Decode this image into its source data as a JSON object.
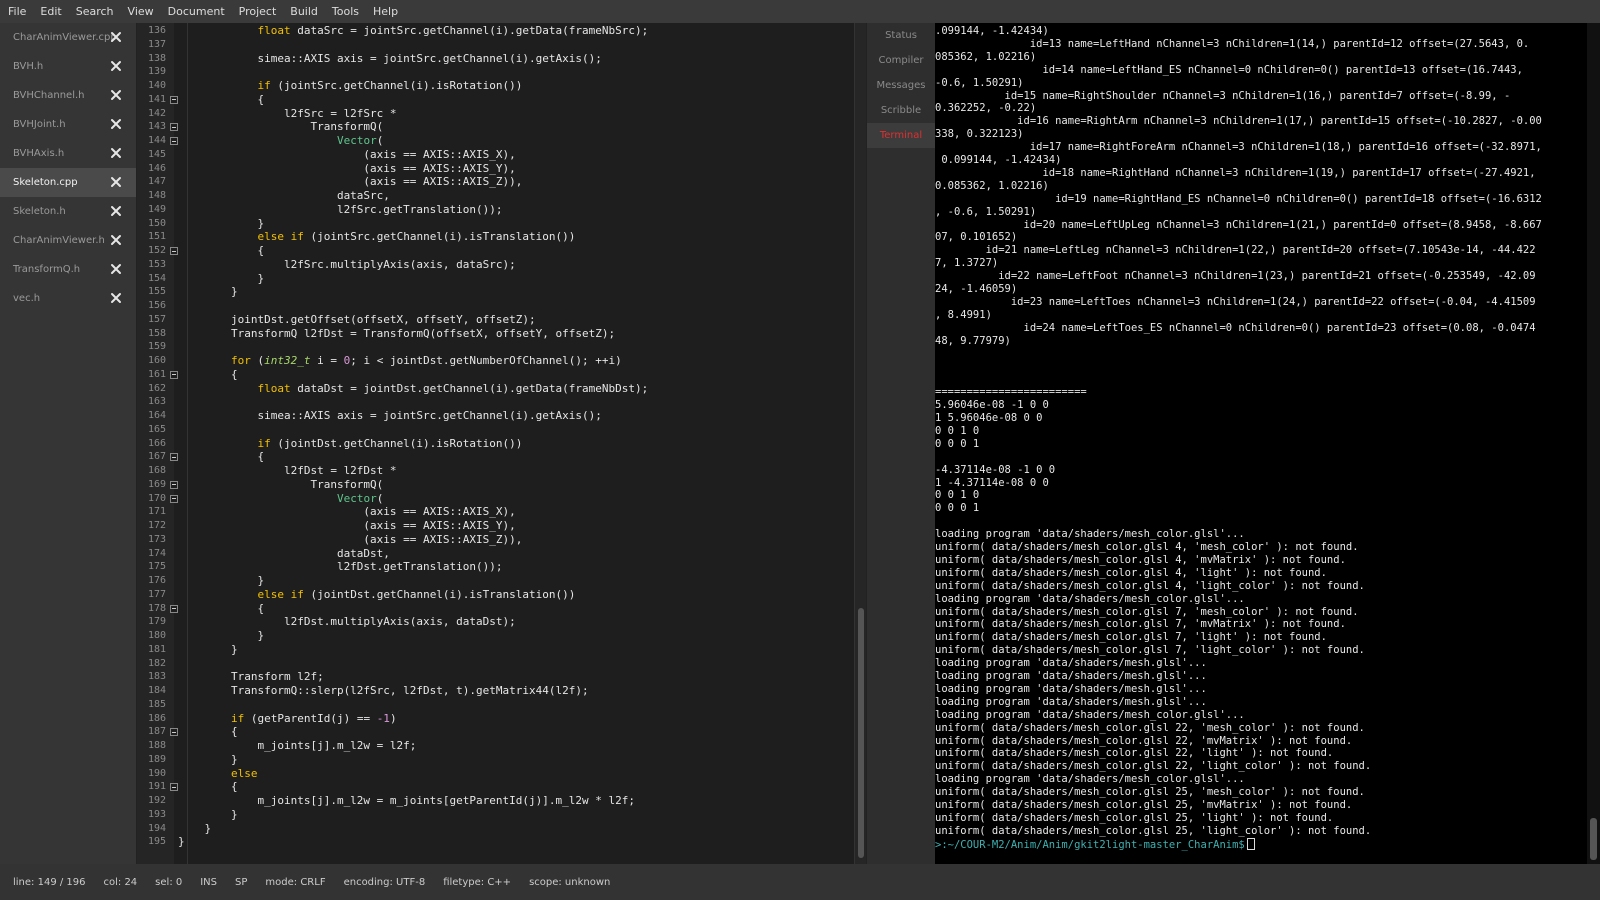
{
  "menubar": [
    "File",
    "Edit",
    "Search",
    "View",
    "Document",
    "Project",
    "Build",
    "Tools",
    "Help"
  ],
  "sidebar": {
    "documents": [
      {
        "name": "CharAnimViewer.cpp",
        "active": false
      },
      {
        "name": "BVH.h",
        "active": false
      },
      {
        "name": "BVHChannel.h",
        "active": false
      },
      {
        "name": "BVHJoint.h",
        "active": false
      },
      {
        "name": "BVHAxis.h",
        "active": false
      },
      {
        "name": "Skeleton.cpp",
        "active": true
      },
      {
        "name": "Skeleton.h",
        "active": false
      },
      {
        "name": "CharAnimViewer.h",
        "active": false
      },
      {
        "name": "TransformQ.h",
        "active": false
      },
      {
        "name": "vec.h",
        "active": false
      }
    ]
  },
  "editor": {
    "lines": [
      {
        "n": "136",
        "fold": false,
        "code": "            float dataSrc = jointSrc.getChannel(i).getData(frameNbSrc);"
      },
      {
        "n": "137",
        "fold": false,
        "code": ""
      },
      {
        "n": "138",
        "fold": false,
        "code": "            simea::AXIS axis = jointSrc.getChannel(i).getAxis();"
      },
      {
        "n": "139",
        "fold": false,
        "code": ""
      },
      {
        "n": "140",
        "fold": false,
        "code": "            if (jointSrc.getChannel(i).isRotation())"
      },
      {
        "n": "141",
        "fold": true,
        "code": "            {"
      },
      {
        "n": "142",
        "fold": false,
        "code": "                l2fSrc = l2fSrc *"
      },
      {
        "n": "143",
        "fold": true,
        "code": "                    TransformQ("
      },
      {
        "n": "144",
        "fold": true,
        "code": "                        Vector("
      },
      {
        "n": "145",
        "fold": false,
        "code": "                            (axis == AXIS::AXIS_X),"
      },
      {
        "n": "146",
        "fold": false,
        "code": "                            (axis == AXIS::AXIS_Y),"
      },
      {
        "n": "147",
        "fold": false,
        "code": "                            (axis == AXIS::AXIS_Z)),"
      },
      {
        "n": "148",
        "fold": false,
        "code": "                        dataSrc,"
      },
      {
        "n": "149",
        "fold": false,
        "code": "                        l2fSrc.getTranslation());"
      },
      {
        "n": "150",
        "fold": false,
        "code": "            }"
      },
      {
        "n": "151",
        "fold": false,
        "code": "            else if (jointSrc.getChannel(i).isTranslation())"
      },
      {
        "n": "152",
        "fold": true,
        "code": "            {"
      },
      {
        "n": "153",
        "fold": false,
        "code": "                l2fSrc.multiplyAxis(axis, dataSrc);"
      },
      {
        "n": "154",
        "fold": false,
        "code": "            }"
      },
      {
        "n": "155",
        "fold": false,
        "code": "        }"
      },
      {
        "n": "156",
        "fold": false,
        "code": ""
      },
      {
        "n": "157",
        "fold": false,
        "code": "        jointDst.getOffset(offsetX, offsetY, offsetZ);"
      },
      {
        "n": "158",
        "fold": false,
        "code": "        TransformQ l2fDst = TransformQ(offsetX, offsetY, offsetZ);"
      },
      {
        "n": "159",
        "fold": false,
        "code": ""
      },
      {
        "n": "160",
        "fold": false,
        "code": "        for (int32_t i = 0; i < jointDst.getNumberOfChannel(); ++i)"
      },
      {
        "n": "161",
        "fold": true,
        "code": "        {"
      },
      {
        "n": "162",
        "fold": false,
        "code": "            float dataDst = jointDst.getChannel(i).getData(frameNbDst);"
      },
      {
        "n": "163",
        "fold": false,
        "code": ""
      },
      {
        "n": "164",
        "fold": false,
        "code": "            simea::AXIS axis = jointSrc.getChannel(i).getAxis();"
      },
      {
        "n": "165",
        "fold": false,
        "code": ""
      },
      {
        "n": "166",
        "fold": false,
        "code": "            if (jointDst.getChannel(i).isRotation())"
      },
      {
        "n": "167",
        "fold": true,
        "code": "            {"
      },
      {
        "n": "168",
        "fold": false,
        "code": "                l2fDst = l2fDst *"
      },
      {
        "n": "169",
        "fold": true,
        "code": "                    TransformQ("
      },
      {
        "n": "170",
        "fold": true,
        "code": "                        Vector("
      },
      {
        "n": "171",
        "fold": false,
        "code": "                            (axis == AXIS::AXIS_X),"
      },
      {
        "n": "172",
        "fold": false,
        "code": "                            (axis == AXIS::AXIS_Y),"
      },
      {
        "n": "173",
        "fold": false,
        "code": "                            (axis == AXIS::AXIS_Z)),"
      },
      {
        "n": "174",
        "fold": false,
        "code": "                        dataDst,"
      },
      {
        "n": "175",
        "fold": false,
        "code": "                        l2fDst.getTranslation());"
      },
      {
        "n": "176",
        "fold": false,
        "code": "            }"
      },
      {
        "n": "177",
        "fold": false,
        "code": "            else if (jointDst.getChannel(i).isTranslation())"
      },
      {
        "n": "178",
        "fold": true,
        "code": "            {"
      },
      {
        "n": "179",
        "fold": false,
        "code": "                l2fDst.multiplyAxis(axis, dataDst);"
      },
      {
        "n": "180",
        "fold": false,
        "code": "            }"
      },
      {
        "n": "181",
        "fold": false,
        "code": "        }"
      },
      {
        "n": "182",
        "fold": false,
        "code": ""
      },
      {
        "n": "183",
        "fold": false,
        "code": "        Transform l2f;"
      },
      {
        "n": "184",
        "fold": false,
        "code": "        TransformQ::slerp(l2fSrc, l2fDst, t).getMatrix44(l2f);"
      },
      {
        "n": "185",
        "fold": false,
        "code": ""
      },
      {
        "n": "186",
        "fold": false,
        "code": "        if (getParentId(j) == -1)"
      },
      {
        "n": "187",
        "fold": true,
        "code": "        {"
      },
      {
        "n": "188",
        "fold": false,
        "code": "            m_joints[j].m_l2w = l2f;"
      },
      {
        "n": "189",
        "fold": false,
        "code": "        }"
      },
      {
        "n": "190",
        "fold": false,
        "code": "        else"
      },
      {
        "n": "191",
        "fold": true,
        "code": "        {"
      },
      {
        "n": "192",
        "fold": false,
        "code": "            m_joints[j].m_l2w = m_joints[getParentId(j)].m_l2w * l2f;"
      },
      {
        "n": "193",
        "fold": false,
        "code": "        }"
      },
      {
        "n": "194",
        "fold": false,
        "code": "    }"
      },
      {
        "n": "195",
        "fold": false,
        "code": "}"
      }
    ]
  },
  "message_tabs": [
    {
      "label": "Status",
      "active": false
    },
    {
      "label": "Compiler",
      "active": false
    },
    {
      "label": "Messages",
      "active": false
    },
    {
      "label": "Scribble",
      "active": false
    },
    {
      "label": "Terminal",
      "active": true
    }
  ],
  "terminal": {
    "lines": [
      ".099144, -1.42434)",
      "               id=13 name=LeftHand nChannel=3 nChildren=1(14,) parentId=12 offset=(27.5643, 0.",
      "085362, 1.02216)",
      "                 id=14 name=LeftHand_ES nChannel=0 nChildren=0() parentId=13 offset=(16.7443,",
      "-0.6, 1.50291)",
      "           id=15 name=RightShoulder nChannel=3 nChildren=1(16,) parentId=7 offset=(-8.99, -",
      "0.362252, -0.22)",
      "             id=16 name=RightArm nChannel=3 nChildren=1(17,) parentId=15 offset=(-10.2827, -0.00",
      "338, 0.322123)",
      "               id=17 name=RightForeArm nChannel=3 nChildren=1(18,) parentId=16 offset=(-32.8971,",
      " 0.099144, -1.42434)",
      "                 id=18 name=RightHand nChannel=3 nChildren=1(19,) parentId=17 offset=(-27.4921,",
      "0.085362, 1.02216)",
      "                   id=19 name=RightHand_ES nChannel=0 nChildren=0() parentId=18 offset=(-16.6312",
      ", -0.6, 1.50291)",
      "              id=20 name=LeftUpLeg nChannel=3 nChildren=1(21,) parentId=0 offset=(8.9458, -8.667",
      "07, 0.101652)",
      "        id=21 name=LeftLeg nChannel=3 nChildren=1(22,) parentId=20 offset=(7.10543e-14, -44.422",
      "7, 1.3727)",
      "          id=22 name=LeftFoot nChannel=3 nChildren=1(23,) parentId=21 offset=(-0.253549, -42.09",
      "24, -1.46059)",
      "            id=23 name=LeftToes nChannel=3 nChildren=1(24,) parentId=22 offset=(-0.04, -4.41509",
      ", 8.4991)",
      "              id=24 name=LeftToes_ES nChannel=0 nChildren=0() parentId=23 offset=(0.08, -0.0474",
      "48, 9.77979)",
      "",
      "",
      "",
      "========================",
      "5.96046e-08 -1 0 0",
      "1 5.96046e-08 0 0",
      "0 0 1 0",
      "0 0 0 1",
      "",
      "-4.37114e-08 -1 0 0",
      "1 -4.37114e-08 0 0",
      "0 0 1 0",
      "0 0 0 1",
      "",
      "loading program 'data/shaders/mesh_color.glsl'...",
      "uniform( data/shaders/mesh_color.glsl 4, 'mesh_color' ): not found.",
      "uniform( data/shaders/mesh_color.glsl 4, 'mvMatrix' ): not found.",
      "uniform( data/shaders/mesh_color.glsl 4, 'light' ): not found.",
      "uniform( data/shaders/mesh_color.glsl 4, 'light_color' ): not found.",
      "loading program 'data/shaders/mesh_color.glsl'...",
      "uniform( data/shaders/mesh_color.glsl 7, 'mesh_color' ): not found.",
      "uniform( data/shaders/mesh_color.glsl 7, 'mvMatrix' ): not found.",
      "uniform( data/shaders/mesh_color.glsl 7, 'light' ): not found.",
      "uniform( data/shaders/mesh_color.glsl 7, 'light_color' ): not found.",
      "loading program 'data/shaders/mesh.glsl'...",
      "loading program 'data/shaders/mesh.glsl'...",
      "loading program 'data/shaders/mesh.glsl'...",
      "loading program 'data/shaders/mesh.glsl'...",
      "loading program 'data/shaders/mesh_color.glsl'...",
      "uniform( data/shaders/mesh_color.glsl 22, 'mesh_color' ): not found.",
      "uniform( data/shaders/mesh_color.glsl 22, 'mvMatrix' ): not found.",
      "uniform( data/shaders/mesh_color.glsl 22, 'light' ): not found.",
      "uniform( data/shaders/mesh_color.glsl 22, 'light_color' ): not found.",
      "loading program 'data/shaders/mesh_color.glsl'...",
      "uniform( data/shaders/mesh_color.glsl 25, 'mesh_color' ): not found.",
      "uniform( data/shaders/mesh_color.glsl 25, 'mvMatrix' ): not found.",
      "uniform( data/shaders/mesh_color.glsl 25, 'light' ): not found.",
      "uniform( data/shaders/mesh_color.glsl 25, 'light_color' ): not found."
    ],
    "prompt": ">:~/COUR-M2/Anim/Anim/gkit2light-master_CharAnim$"
  },
  "statusbar": {
    "line": "line: 149 / 196",
    "col": "col: 24",
    "sel": "sel: 0",
    "ins": "INS",
    "sp": "SP",
    "mode": "mode: CRLF",
    "encoding": "encoding: UTF-8",
    "filetype": "filetype: C++",
    "scope": "scope: unknown"
  },
  "colors": {
    "keyword": "#f2c000",
    "type": "#a8d86a",
    "class": "#5fc48c",
    "number": "#d99ad9",
    "active_tab": "#e03030",
    "prompt": "#3fb0b0"
  }
}
